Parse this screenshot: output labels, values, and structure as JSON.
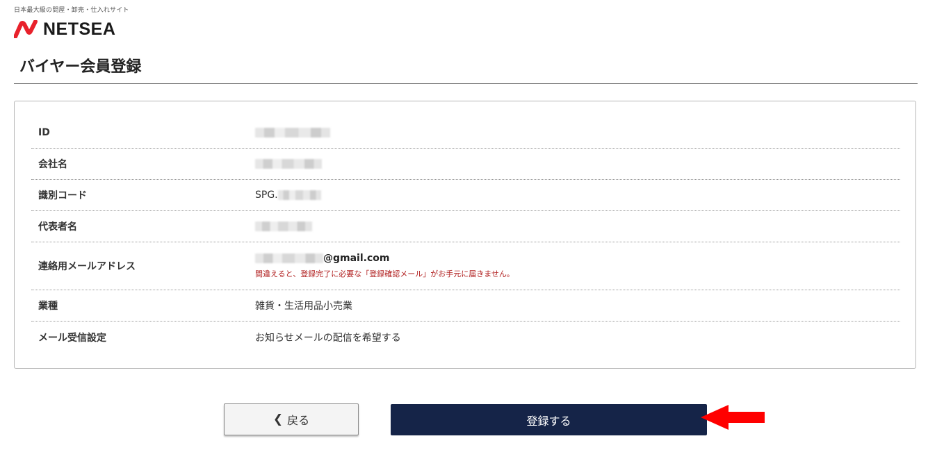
{
  "header": {
    "tagline": "日本最大級の問屋・卸売・仕入れサイト",
    "logo_text": "NETSEA",
    "page_title": "バイヤー会員登録"
  },
  "rows": [
    {
      "label": "ID",
      "value": "",
      "masked": true
    },
    {
      "label": "会社名",
      "value": "",
      "masked": true
    },
    {
      "label": "識別コード",
      "value": "SPG.",
      "masked": true
    },
    {
      "label": "代表者名",
      "value": "",
      "masked": true
    },
    {
      "label": "連絡用メールアドレス",
      "value": "@gmail.com",
      "masked": true,
      "note": "間違えると、登録完了に必要な「登録確認メール」がお手元に届きません。"
    },
    {
      "label": "業種",
      "value": "雑貨・生活用品小売業",
      "masked": false
    },
    {
      "label": "メール受信設定",
      "value": "お知らせメールの配信を希望する",
      "masked": false
    }
  ],
  "buttons": {
    "back_label": "戻る",
    "back_icon": "chevron-left-icon",
    "submit_label": "登録する"
  },
  "colors": {
    "brand_red": "#e8212b",
    "submit_bg": "#152448",
    "warning_text": "#b22222",
    "annotation_arrow": "#ff0000"
  }
}
